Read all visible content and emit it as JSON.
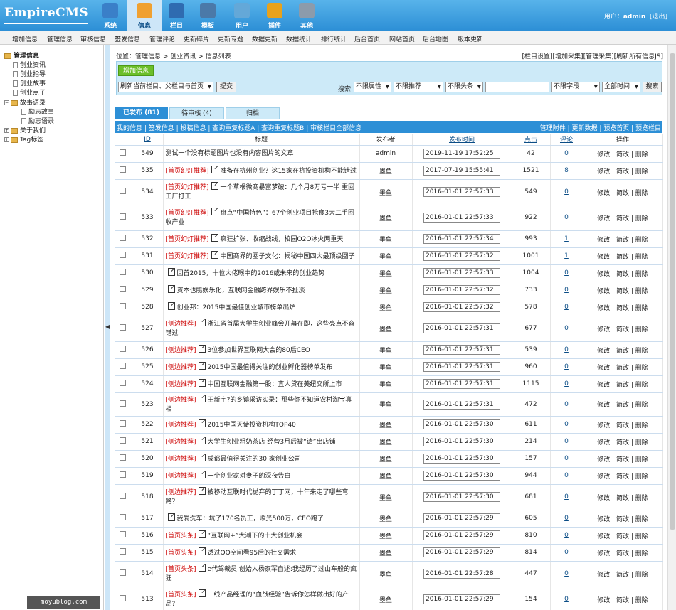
{
  "app": {
    "logo": "EmpireCMS"
  },
  "nav": [
    {
      "label": "系统",
      "icon": "globe-icon",
      "color": "#3a7fc8"
    },
    {
      "label": "信息",
      "icon": "edit-icon",
      "color": "#f0a030"
    },
    {
      "label": "栏目",
      "icon": "folder-icon",
      "color": "#2f6bb0"
    },
    {
      "label": "模板",
      "icon": "template-icon",
      "color": "#4b79a8"
    },
    {
      "label": "用户",
      "icon": "user-icon",
      "color": "#64a8d8"
    },
    {
      "label": "插件",
      "icon": "plugin-icon",
      "color": "#e8a21c"
    },
    {
      "label": "其他",
      "icon": "gear-icon",
      "color": "#8c9bab"
    }
  ],
  "user": {
    "prefix": "用户：",
    "name": "admin",
    "logout": "[退出]"
  },
  "menu": [
    "增加信息",
    "管理信息",
    "审核信息",
    "签发信息",
    "管理评论",
    "更新碎片",
    "更新专题",
    "数据更新",
    "数据统计",
    "排行统计",
    "后台首页",
    "网站首页",
    "后台地图",
    "版本更新"
  ],
  "tree": {
    "root": "管理信息",
    "items": [
      "创业资讯",
      "创业指导",
      "创业故事",
      "创业点子"
    ],
    "folder1": "故事语录",
    "sub": [
      "励志故事",
      "励志语录"
    ],
    "folder2": "关于我们",
    "folder3": "Tag标签"
  },
  "position": {
    "text": "位置：",
    "p1": "管理信息",
    "sep": " > ",
    "p2": "创业资讯",
    "p3": "信息列表"
  },
  "toplinks": [
    "[栏目设置]",
    "[增加采集]",
    "[管理采集]",
    "[刷新所有信息JS]"
  ],
  "panel": {
    "add_button": "增加信息",
    "refresh_select": "刷新当前栏目、父栏目与首页",
    "submit": "提交",
    "search_label": "搜索:",
    "attr": "不限属性",
    "recommend": "不限推荐",
    "headline": "不限头条",
    "field": "不限字段",
    "time": "全部时间",
    "search_button": "搜索"
  },
  "tabs": [
    "已发布 (81)",
    "待审核 (4)",
    "归档"
  ],
  "bluebar": {
    "left": "我的信息 | 签发信息 | 投稿信息 | 查询重复标题A | 查询重复标题B | 审核栏目全部信息",
    "right": "管理附件 | 更新数据 | 预览首页 | 预览栏目"
  },
  "table": {
    "headers": [
      "",
      "ID",
      "标题",
      "发布者",
      "发布时间",
      "点击",
      "评论",
      "操作"
    ],
    "ops": "修改 | 简改 | 删除",
    "rows": [
      {
        "id": "549",
        "tag": "",
        "icon": false,
        "title": "测试一个没有标题图片也没有内容图片的文章",
        "author": "admin",
        "time": "2019-11-19 17:52:25",
        "clicks": "42",
        "comments": "0",
        "h": 24
      },
      {
        "id": "535",
        "tag": "[首页幻灯推荐]",
        "icon": true,
        "title": "准备在杭州创业？这15家在杭投资机构不能错过",
        "author": "墨鱼",
        "time": "2017-07-19 15:55:41",
        "clicks": "1521",
        "comments": "8",
        "h": 24
      },
      {
        "id": "534",
        "tag": "[首页幻灯推荐]",
        "icon": true,
        "title": "一个草根微商暴富梦破：几个月8万亏一半 重回工厂打工",
        "author": "墨鱼",
        "time": "2016-01-01 22:57:33",
        "clicks": "549",
        "comments": "0",
        "h": 36
      },
      {
        "id": "533",
        "tag": "[首页幻灯推荐]",
        "icon": true,
        "title": "盘点“中国特色”：67个创业项目抢食3大二手回收产业",
        "author": "墨鱼",
        "time": "2016-01-01 22:57:33",
        "clicks": "922",
        "comments": "0",
        "h": 36
      },
      {
        "id": "532",
        "tag": "[首页幻灯推荐]",
        "icon": true,
        "title": "疯狂扩张、收缩战线，校园O2O冰火两重天",
        "author": "墨鱼",
        "time": "2016-01-01 22:57:34",
        "clicks": "993",
        "comments": "1",
        "h": 24
      },
      {
        "id": "531",
        "tag": "[首页幻灯推荐]",
        "icon": true,
        "title": "中国商界的圈子文化：揭秘中国四大最顶级圈子",
        "author": "墨鱼",
        "time": "2016-01-01 22:57:32",
        "clicks": "1001",
        "comments": "1",
        "h": 24
      },
      {
        "id": "530",
        "tag": "",
        "icon": true,
        "title": "回首2015，十位大佬眼中的2016或未来的创业趋势",
        "author": "墨鱼",
        "time": "2016-01-01 22:57:33",
        "clicks": "1004",
        "comments": "0",
        "h": 24
      },
      {
        "id": "529",
        "tag": "",
        "icon": true,
        "title": "资本也能娱乐化，互联网金融跨界娱乐不扯淡",
        "author": "墨鱼",
        "time": "2016-01-01 22:57:32",
        "clicks": "733",
        "comments": "0",
        "h": 24
      },
      {
        "id": "528",
        "tag": "",
        "icon": true,
        "title": "创业邦：2015中国最佳创业城市榜单出炉",
        "author": "墨鱼",
        "time": "2016-01-01 22:57:32",
        "clicks": "578",
        "comments": "0",
        "h": 24
      },
      {
        "id": "527",
        "tag": "[侧边推荐]",
        "icon": true,
        "title": "浙江省首届大学生创业峰会开幕在即，这些亮点不容错过",
        "author": "墨鱼",
        "time": "2016-01-01 22:57:31",
        "clicks": "677",
        "comments": "0",
        "h": 36
      },
      {
        "id": "526",
        "tag": "[侧边推荐]",
        "icon": true,
        "title": "3位参加世界互联网大会的80后CEO",
        "author": "墨鱼",
        "time": "2016-01-01 22:57:31",
        "clicks": "539",
        "comments": "0",
        "h": 24
      },
      {
        "id": "525",
        "tag": "[侧边推荐]",
        "icon": true,
        "title": "2015中国最值得关注的创业孵化器榜单发布",
        "author": "墨鱼",
        "time": "2016-01-01 22:57:31",
        "clicks": "960",
        "comments": "0",
        "h": 24
      },
      {
        "id": "524",
        "tag": "[侧边推荐]",
        "icon": true,
        "title": "中国互联网金融第一股：宜人贷在美纽交所上市",
        "author": "墨鱼",
        "time": "2016-01-01 22:57:31",
        "clicks": "1115",
        "comments": "0",
        "h": 24
      },
      {
        "id": "523",
        "tag": "[侧边推荐]",
        "icon": true,
        "title": "王新宇?的乡镇采访实录：那些你不知道农村淘宝真相",
        "author": "墨鱼",
        "time": "2016-01-01 22:57:31",
        "clicks": "472",
        "comments": "0",
        "h": 24
      },
      {
        "id": "522",
        "tag": "[侧边推荐]",
        "icon": true,
        "title": "2015中国天使投资机构TOP40",
        "author": "墨鱼",
        "time": "2016-01-01 22:57:30",
        "clicks": "611",
        "comments": "0",
        "h": 24
      },
      {
        "id": "521",
        "tag": "[侧边推荐]",
        "icon": true,
        "title": "大学生创业粗奶茶店 经营3月后被“请”出店铺",
        "author": "墨鱼",
        "time": "2016-01-01 22:57:30",
        "clicks": "214",
        "comments": "0",
        "h": 24
      },
      {
        "id": "520",
        "tag": "[侧边推荐]",
        "icon": true,
        "title": "成都最值得关注的30 家创业公司",
        "author": "墨鱼",
        "time": "2016-01-01 22:57:30",
        "clicks": "157",
        "comments": "0",
        "h": 24
      },
      {
        "id": "519",
        "tag": "[侧边推荐]",
        "icon": true,
        "title": "一个创业家对妻子的深夜告白",
        "author": "墨鱼",
        "time": "2016-01-01 22:57:30",
        "clicks": "944",
        "comments": "0",
        "h": 24
      },
      {
        "id": "518",
        "tag": "[侧边推荐]",
        "icon": true,
        "title": "被移动互联时代抛弃的丁丁网，十年来走了哪些弯路？",
        "author": "墨鱼",
        "time": "2016-01-01 22:57:30",
        "clicks": "681",
        "comments": "0",
        "h": 36
      },
      {
        "id": "517",
        "tag": "",
        "icon": true,
        "title": "我爱洗车：坑了170名员工，败光500万，CEO跑了",
        "author": "墨鱼",
        "time": "2016-01-01 22:57:29",
        "clicks": "605",
        "comments": "0",
        "h": 24
      },
      {
        "id": "516",
        "tag": "[首页头条]",
        "icon": true,
        "title": "“互联网+”大潮下的十大创业机会",
        "author": "墨鱼",
        "time": "2016-01-01 22:57:29",
        "clicks": "810",
        "comments": "0",
        "h": 24
      },
      {
        "id": "515",
        "tag": "[首页头条]",
        "icon": true,
        "title": "透过QQ空间看95后的社交需求",
        "author": "墨鱼",
        "time": "2016-01-01 22:57:29",
        "clicks": "814",
        "comments": "0",
        "h": 24
      },
      {
        "id": "514",
        "tag": "[首页头条]",
        "icon": true,
        "title": "e代驾裁员 创始人杨家军自述:我经历了过山车般的疯狂",
        "author": "墨鱼",
        "time": "2016-01-01 22:57:28",
        "clicks": "447",
        "comments": "0",
        "h": 36
      },
      {
        "id": "513",
        "tag": "[首页头条]",
        "icon": true,
        "title": "一线产品经理的“血战经验”告诉你怎样做出好的产品?",
        "author": "墨鱼",
        "time": "2016-01-01 22:57:29",
        "clicks": "154",
        "comments": "0",
        "h": 36
      }
    ]
  },
  "watermark": "moyublog.com"
}
